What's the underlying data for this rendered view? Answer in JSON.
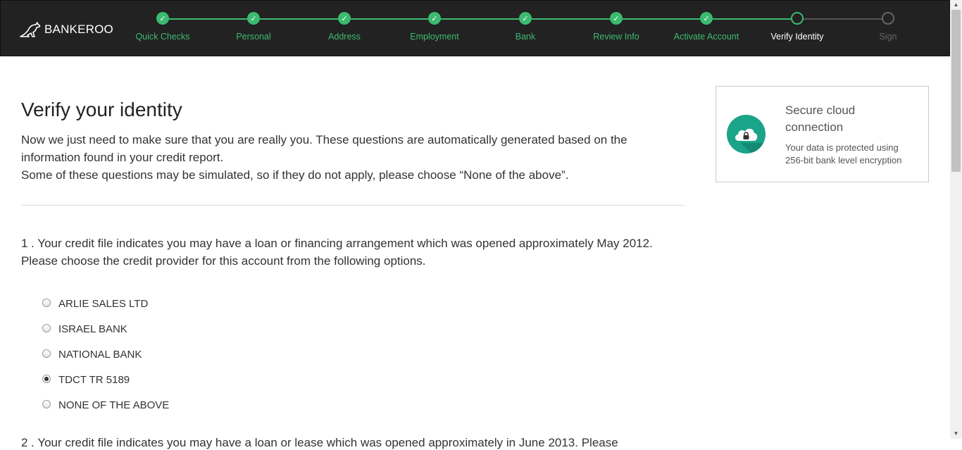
{
  "header": {
    "logo_text": "BANKEROO",
    "steps": [
      {
        "label": "Quick Checks",
        "state": "done"
      },
      {
        "label": "Personal",
        "state": "done"
      },
      {
        "label": "Address",
        "state": "done"
      },
      {
        "label": "Employment",
        "state": "done"
      },
      {
        "label": "Bank",
        "state": "done"
      },
      {
        "label": "Review Info",
        "state": "done"
      },
      {
        "label": "Activate Account",
        "state": "done"
      },
      {
        "label": "Verify Identity",
        "state": "current"
      },
      {
        "label": "Sign",
        "state": "todo"
      }
    ],
    "check_glyph": "✓"
  },
  "main": {
    "title": "Verify your identity",
    "intro_1": "Now we just need to make sure that you are really you. These questions are automatically generated based on the information found in your credit report.",
    "intro_2": "Some of these questions may be simulated, so if they do not apply, please choose “None of the above”.",
    "question_1": "1 . Your credit file indicates you may have a loan or financing arrangement which was opened approximately May 2012. Please choose the credit provider for this account from the following options.",
    "options": [
      {
        "label": "ARLIE SALES LTD",
        "checked": false
      },
      {
        "label": "ISRAEL BANK",
        "checked": false
      },
      {
        "label": "NATIONAL BANK",
        "checked": false
      },
      {
        "label": "TDCT TR 5189",
        "checked": true
      },
      {
        "label": "NONE OF THE ABOVE",
        "checked": false
      }
    ],
    "question_2_partial": "2 . Your credit file indicates you may have a loan or lease which was opened approximately in June 2013. Please"
  },
  "secure": {
    "title": "Secure cloud connection",
    "text": "Your data is protected using 256-bit bank level encryption",
    "icon": "cloud-lock-icon"
  },
  "colors": {
    "header_bg": "#222222",
    "accent_green": "#3cba70",
    "icon_teal": "#1aa489"
  }
}
